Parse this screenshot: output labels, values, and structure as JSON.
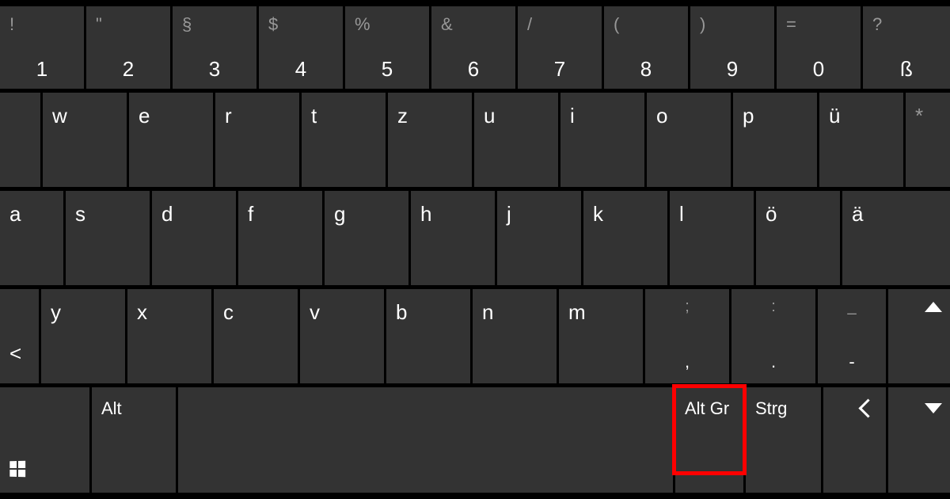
{
  "highlight_key": "altgr",
  "colors": {
    "key_bg": "#333333",
    "gap": "#000000",
    "highlight": "#ff0000"
  },
  "rows": {
    "num": [
      {
        "id": "1",
        "prim": "1",
        "sec": "!"
      },
      {
        "id": "2",
        "prim": "2",
        "sec": "\""
      },
      {
        "id": "3",
        "prim": "3",
        "sec": "§"
      },
      {
        "id": "4",
        "prim": "4",
        "sec": "$"
      },
      {
        "id": "5",
        "prim": "5",
        "sec": "%"
      },
      {
        "id": "6",
        "prim": "6",
        "sec": "&"
      },
      {
        "id": "7",
        "prim": "7",
        "sec": "/"
      },
      {
        "id": "8",
        "prim": "8",
        "sec": "("
      },
      {
        "id": "9",
        "prim": "9",
        "sec": ")"
      },
      {
        "id": "0",
        "prim": "0",
        "sec": "="
      },
      {
        "id": "sz",
        "prim": "ß",
        "sec": "?"
      }
    ],
    "top": [
      {
        "id": "w",
        "prim": "w"
      },
      {
        "id": "e",
        "prim": "e"
      },
      {
        "id": "r",
        "prim": "r"
      },
      {
        "id": "t",
        "prim": "t"
      },
      {
        "id": "z",
        "prim": "z"
      },
      {
        "id": "u",
        "prim": "u"
      },
      {
        "id": "i",
        "prim": "i"
      },
      {
        "id": "o",
        "prim": "o"
      },
      {
        "id": "p",
        "prim": "p"
      },
      {
        "id": "ue",
        "prim": "ü"
      },
      {
        "id": "star",
        "prim": "*"
      }
    ],
    "home": [
      {
        "id": "a",
        "prim": "a"
      },
      {
        "id": "s",
        "prim": "s"
      },
      {
        "id": "d",
        "prim": "d"
      },
      {
        "id": "f",
        "prim": "f"
      },
      {
        "id": "g",
        "prim": "g"
      },
      {
        "id": "h",
        "prim": "h"
      },
      {
        "id": "j",
        "prim": "j"
      },
      {
        "id": "k",
        "prim": "k"
      },
      {
        "id": "l",
        "prim": "l"
      },
      {
        "id": "oe",
        "prim": "ö"
      },
      {
        "id": "ae",
        "prim": "ä"
      }
    ],
    "bottom": [
      {
        "id": "angle",
        "prim": "<"
      },
      {
        "id": "y",
        "prim": "y"
      },
      {
        "id": "x",
        "prim": "x"
      },
      {
        "id": "c",
        "prim": "c"
      },
      {
        "id": "v",
        "prim": "v"
      },
      {
        "id": "b",
        "prim": "b"
      },
      {
        "id": "n",
        "prim": "n"
      },
      {
        "id": "m",
        "prim": "m"
      },
      {
        "id": "comma",
        "prim": ",",
        "sec": ";"
      },
      {
        "id": "period",
        "prim": ".",
        "sec": ":"
      },
      {
        "id": "dash",
        "prim": "-",
        "sec": "_"
      },
      {
        "id": "up",
        "icon": "caret-up"
      }
    ],
    "mod": [
      {
        "id": "winkey",
        "icon": "windows",
        "label": ""
      },
      {
        "id": "alt",
        "label": "Alt"
      },
      {
        "id": "space",
        "label": ""
      },
      {
        "id": "altgr",
        "label": "Alt Gr"
      },
      {
        "id": "strg",
        "label": "Strg"
      },
      {
        "id": "left",
        "icon": "chevron-left"
      },
      {
        "id": "down",
        "icon": "caret-down"
      }
    ]
  }
}
